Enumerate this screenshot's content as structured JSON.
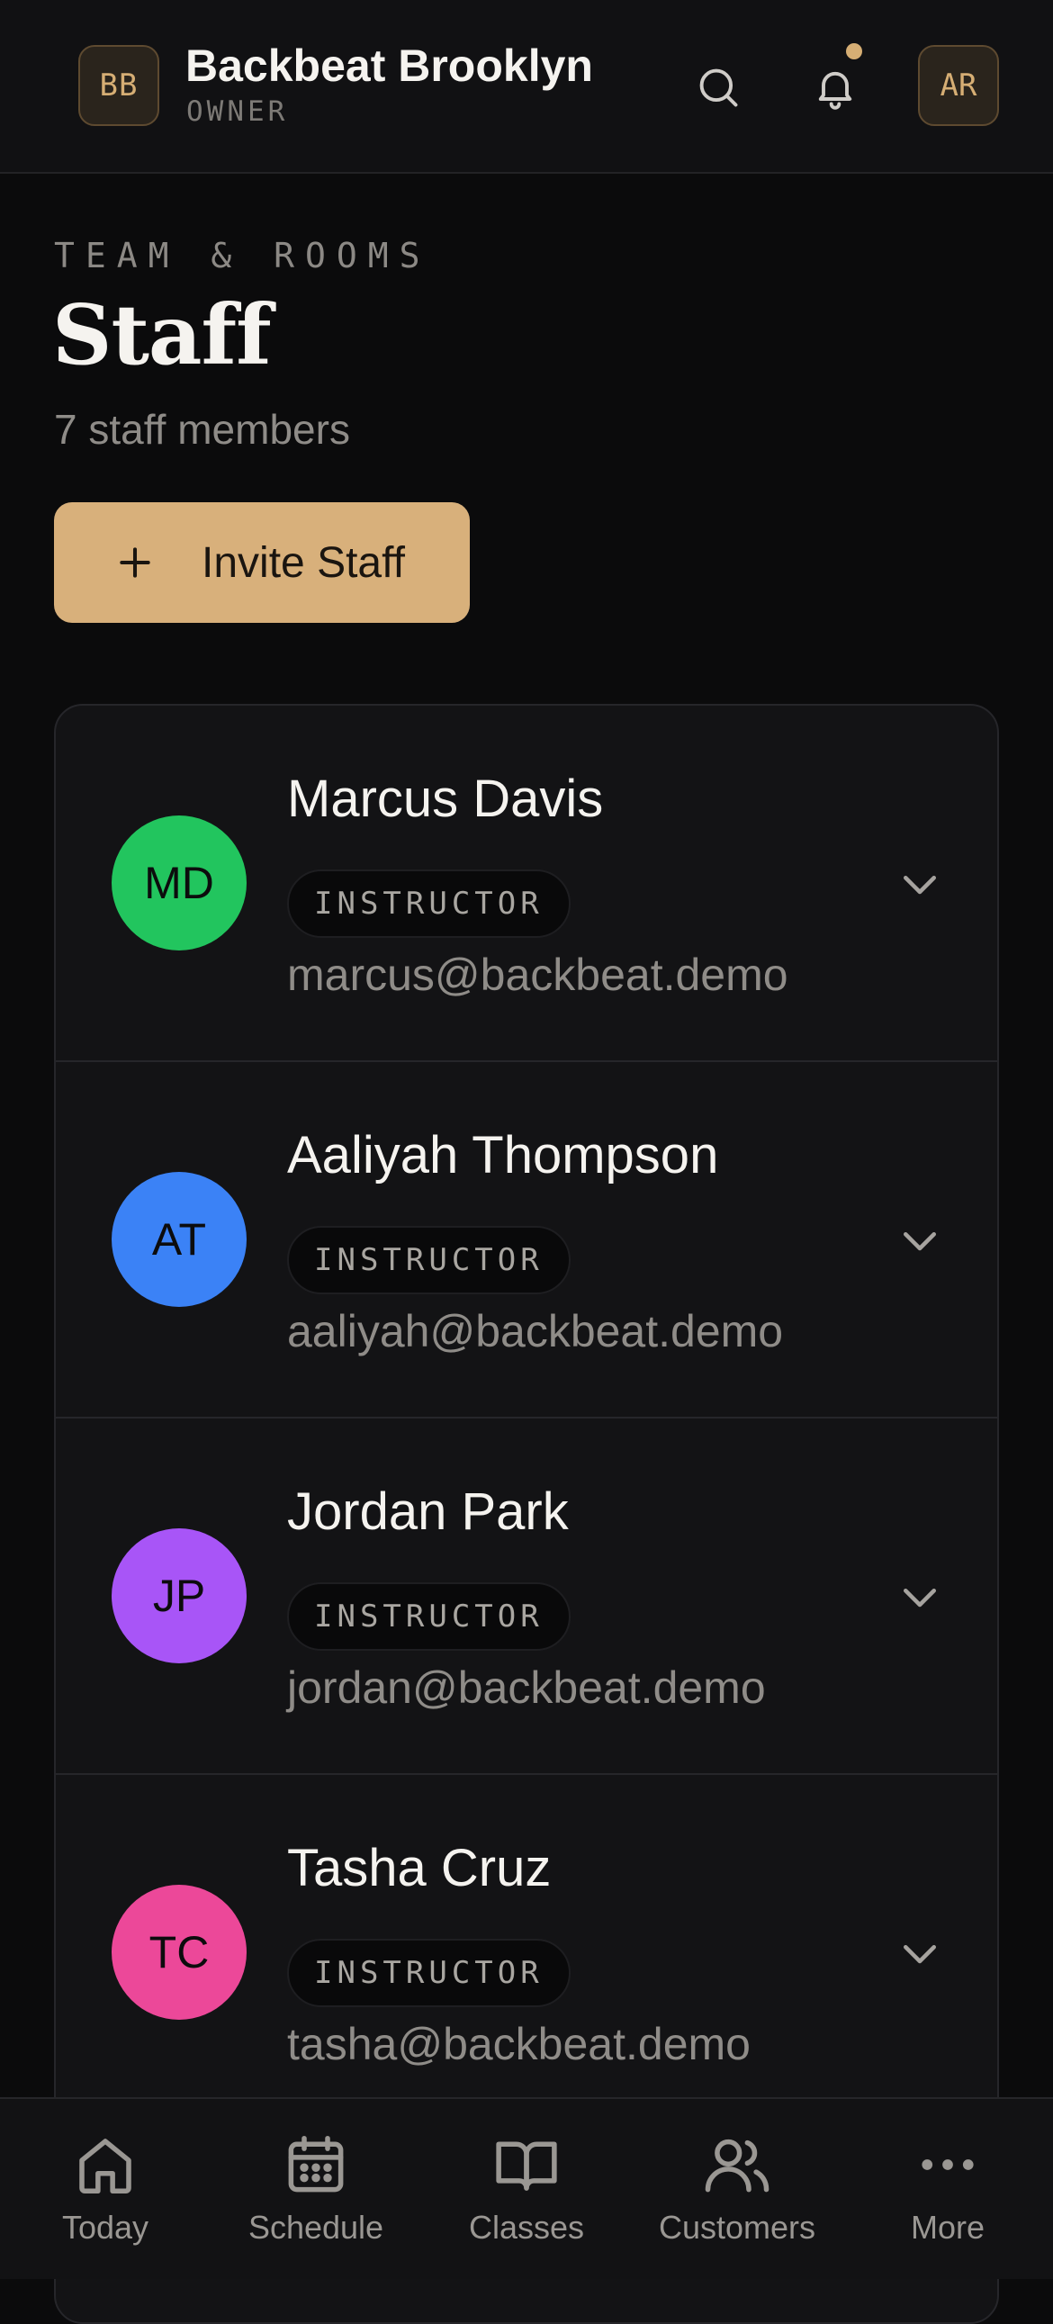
{
  "header": {
    "studio_initials": "BB",
    "studio_name": "Backbeat Brooklyn",
    "studio_role": "OWNER",
    "user_initials": "AR",
    "accent_color": "#d6ae74",
    "has_notification": true
  },
  "page": {
    "eyebrow": "TEAM & ROOMS",
    "title": "Staff",
    "count_text": "7 staff members",
    "invite_label": "Invite Staff"
  },
  "staff": [
    {
      "initials": "MD",
      "name": "Marcus Davis",
      "role": "INSTRUCTOR",
      "email": "marcus@backbeat.demo",
      "color": "#22c55e"
    },
    {
      "initials": "AT",
      "name": "Aaliyah Thompson",
      "role": "INSTRUCTOR",
      "email": "aaliyah@backbeat.demo",
      "color": "#3b82f6"
    },
    {
      "initials": "JP",
      "name": "Jordan Park",
      "role": "INSTRUCTOR",
      "email": "jordan@backbeat.demo",
      "color": "#a855f7"
    },
    {
      "initials": "TC",
      "name": "Tasha Cruz",
      "role": "INSTRUCTOR",
      "email": "tasha@backbeat.demo",
      "color": "#ec4899"
    }
  ],
  "nav": [
    {
      "label": "Today",
      "icon": "home-icon"
    },
    {
      "label": "Schedule",
      "icon": "calendar-icon"
    },
    {
      "label": "Classes",
      "icon": "book-icon"
    },
    {
      "label": "Customers",
      "icon": "users-icon"
    },
    {
      "label": "More",
      "icon": "more-icon"
    }
  ]
}
